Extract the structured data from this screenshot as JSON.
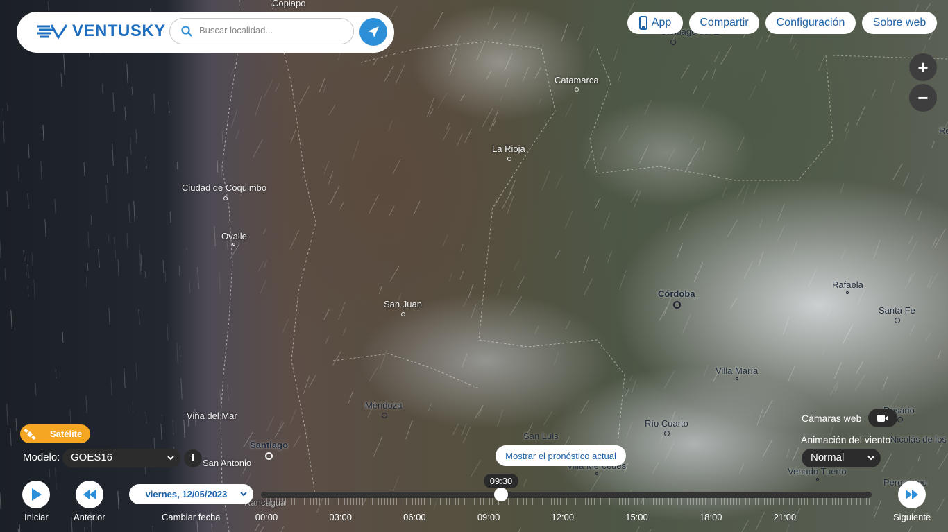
{
  "header": {
    "logo_text": "VENTUSKY",
    "search": {
      "placeholder": "Buscar localidad..."
    },
    "links": [
      {
        "label": "App"
      },
      {
        "label": "Compartir"
      },
      {
        "label": "Configuración"
      },
      {
        "label": "Sobre web"
      }
    ]
  },
  "zoom": {
    "in": "+",
    "out": "−"
  },
  "map": {
    "cities": [
      {
        "name": "Copiapo"
      },
      {
        "name": "Catamarca"
      },
      {
        "name": "La Rioja"
      },
      {
        "name": "Ciudad de Coquimbo"
      },
      {
        "name": "Ovalle"
      },
      {
        "name": "San Juan"
      },
      {
        "name": "Córdoba"
      },
      {
        "name": "Rafaela"
      },
      {
        "name": "Santa Fe"
      },
      {
        "name": "Villa María"
      },
      {
        "name": "Mendoza"
      },
      {
        "name": "Viña del Mar"
      },
      {
        "name": "Santiago"
      },
      {
        "name": "San Luis"
      },
      {
        "name": "Río Cuarto"
      },
      {
        "name": "Villa Mercedes"
      },
      {
        "name": "Venado Tuerto"
      },
      {
        "name": "Rosario"
      },
      {
        "name": "Nicolás de los"
      },
      {
        "name": "Pergamino"
      },
      {
        "name": "Rancagua"
      },
      {
        "name": "San Antonio"
      },
      {
        "name": "Santiago del E"
      },
      {
        "name": "Re"
      }
    ]
  },
  "controls": {
    "layer_label": "Satélite",
    "model_label": "Modelo:",
    "model_value": "GOES16",
    "info_label": "i",
    "play_caption": "Iniciar",
    "prev_caption": "Anterior",
    "date_value": "viernes, 12/05/2023",
    "date_caption": "Cambiar fecha",
    "next_caption": "Siguiente",
    "current_time": "09:30",
    "forecast_button": "Mostrar el pronóstico actual",
    "hours": [
      "00:00",
      "03:00",
      "06:00",
      "09:00",
      "12:00",
      "15:00",
      "18:00",
      "21:00"
    ],
    "webcams_label": "Cámaras web",
    "wind_anim_label": "Animación del viento:",
    "wind_anim_value": "Normal"
  },
  "colors": {
    "accent": "#2d8fd7",
    "brand": "#1e6fc2",
    "satellite_layer": "#f5a623"
  }
}
